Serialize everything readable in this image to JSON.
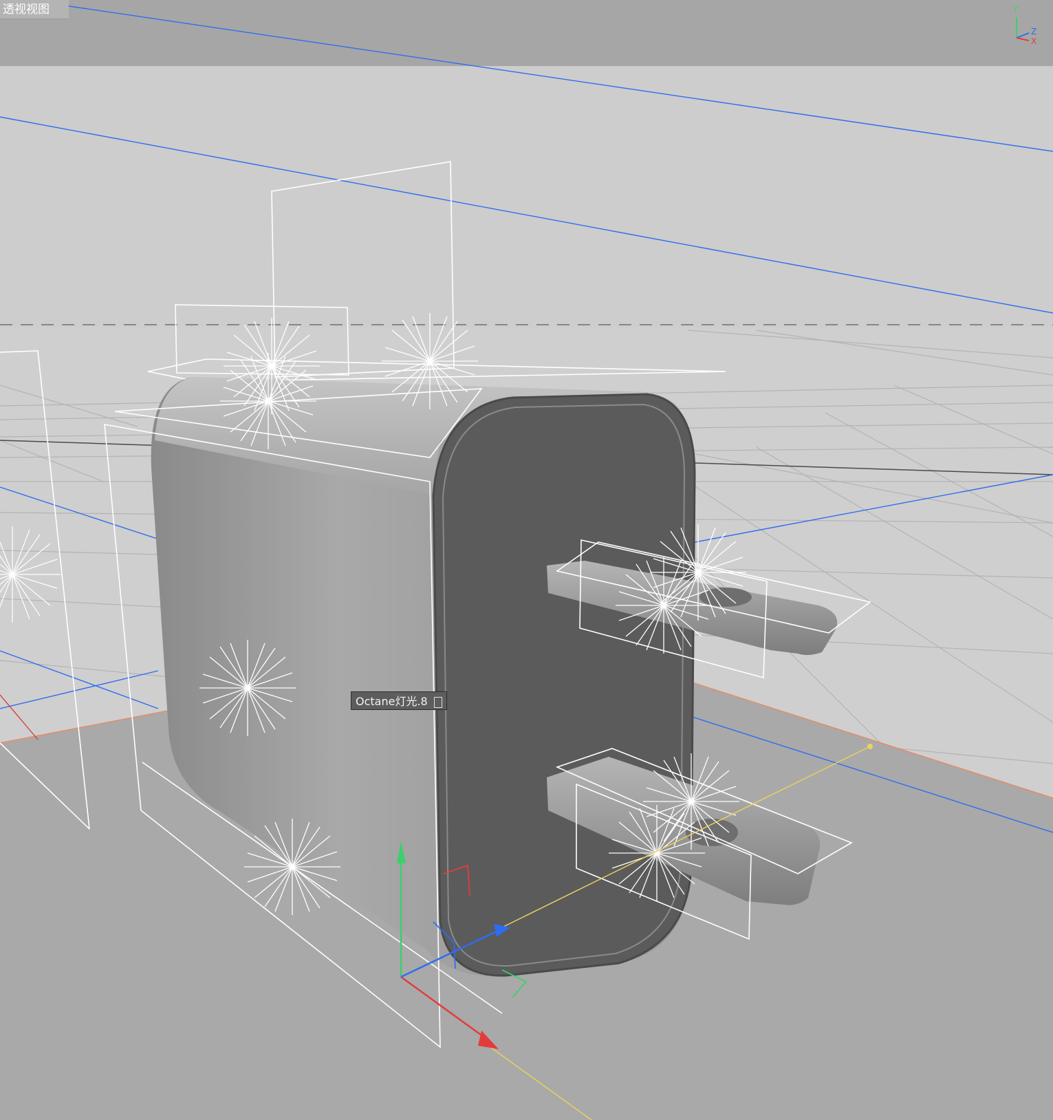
{
  "viewport": {
    "title": "透视视图",
    "background_top": "#a5a5a5",
    "background_floor": "#cbcbcb",
    "floor_color": "#a9a9a9"
  },
  "tooltip": {
    "text": "Octane灯光.8",
    "cursor_icon": "hand-cursor-icon"
  },
  "axis_widget": {
    "y_label": "Y",
    "z_label": "Z",
    "x_label": "X"
  },
  "object": {
    "body_color": "#9a9a9a",
    "face_color": "#5d5d5d",
    "prong_color": "#a0a0a0"
  },
  "gizmo": {
    "y_color": "#3ecf6a",
    "x_color": "#e23c3c",
    "z_color": "#2f6cf0",
    "rail_color": "#e8d060"
  }
}
